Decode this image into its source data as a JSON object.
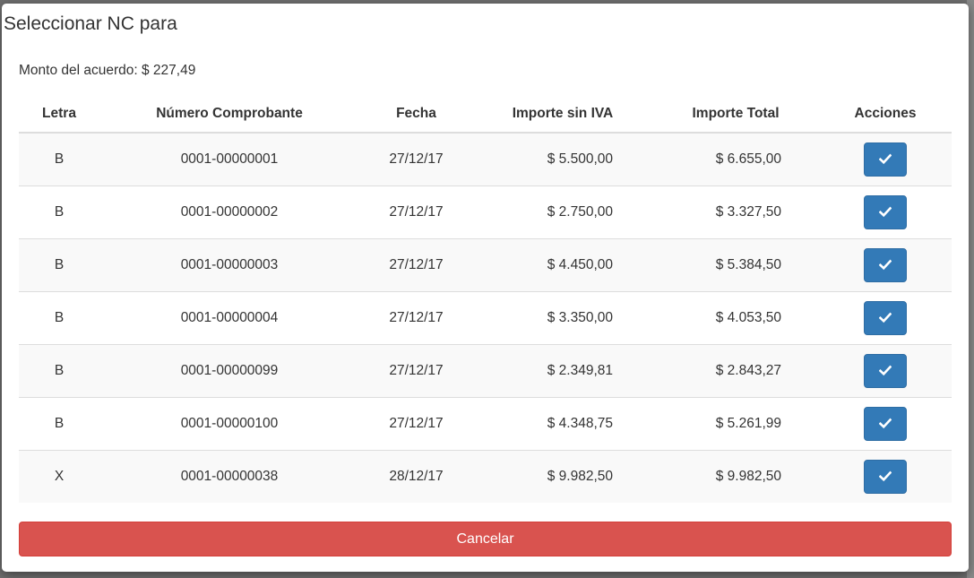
{
  "modal": {
    "title": "Seleccionar NC para",
    "monto_label": "Monto del acuerdo: $ 227,49"
  },
  "table": {
    "headers": {
      "letra": "Letra",
      "numero": "Número Comprobante",
      "fecha": "Fecha",
      "importe_sin_iva": "Importe sin IVA",
      "importe_total": "Importe Total",
      "acciones": "Acciones"
    },
    "rows": [
      {
        "letra": "B",
        "numero": "0001-00000001",
        "fecha": "27/12/17",
        "importe_sin_iva": "$ 5.500,00",
        "importe_total": "$ 6.655,00",
        "action_icon": "check-icon"
      },
      {
        "letra": "B",
        "numero": "0001-00000002",
        "fecha": "27/12/17",
        "importe_sin_iva": "$ 2.750,00",
        "importe_total": "$ 3.327,50",
        "action_icon": "check-icon"
      },
      {
        "letra": "B",
        "numero": "0001-00000003",
        "fecha": "27/12/17",
        "importe_sin_iva": "$ 4.450,00",
        "importe_total": "$ 5.384,50",
        "action_icon": "check-icon"
      },
      {
        "letra": "B",
        "numero": "0001-00000004",
        "fecha": "27/12/17",
        "importe_sin_iva": "$ 3.350,00",
        "importe_total": "$ 4.053,50",
        "action_icon": "check-icon"
      },
      {
        "letra": "B",
        "numero": "0001-00000099",
        "fecha": "27/12/17",
        "importe_sin_iva": "$ 2.349,81",
        "importe_total": "$ 2.843,27",
        "action_icon": "check-icon"
      },
      {
        "letra": "B",
        "numero": "0001-00000100",
        "fecha": "27/12/17",
        "importe_sin_iva": "$ 4.348,75",
        "importe_total": "$ 5.261,99",
        "action_icon": "check-icon"
      },
      {
        "letra": "X",
        "numero": "0001-00000038",
        "fecha": "28/12/17",
        "importe_sin_iva": "$ 9.982,50",
        "importe_total": "$ 9.982,50",
        "action_icon": "check-icon"
      }
    ]
  },
  "footer": {
    "cancel_label": "Cancelar"
  },
  "colors": {
    "primary": "#337ab7",
    "danger": "#d9534f",
    "stripe": "#f9f9f9",
    "border": "#dddddd",
    "text": "#333333",
    "backdrop": "#6f6f6f"
  }
}
